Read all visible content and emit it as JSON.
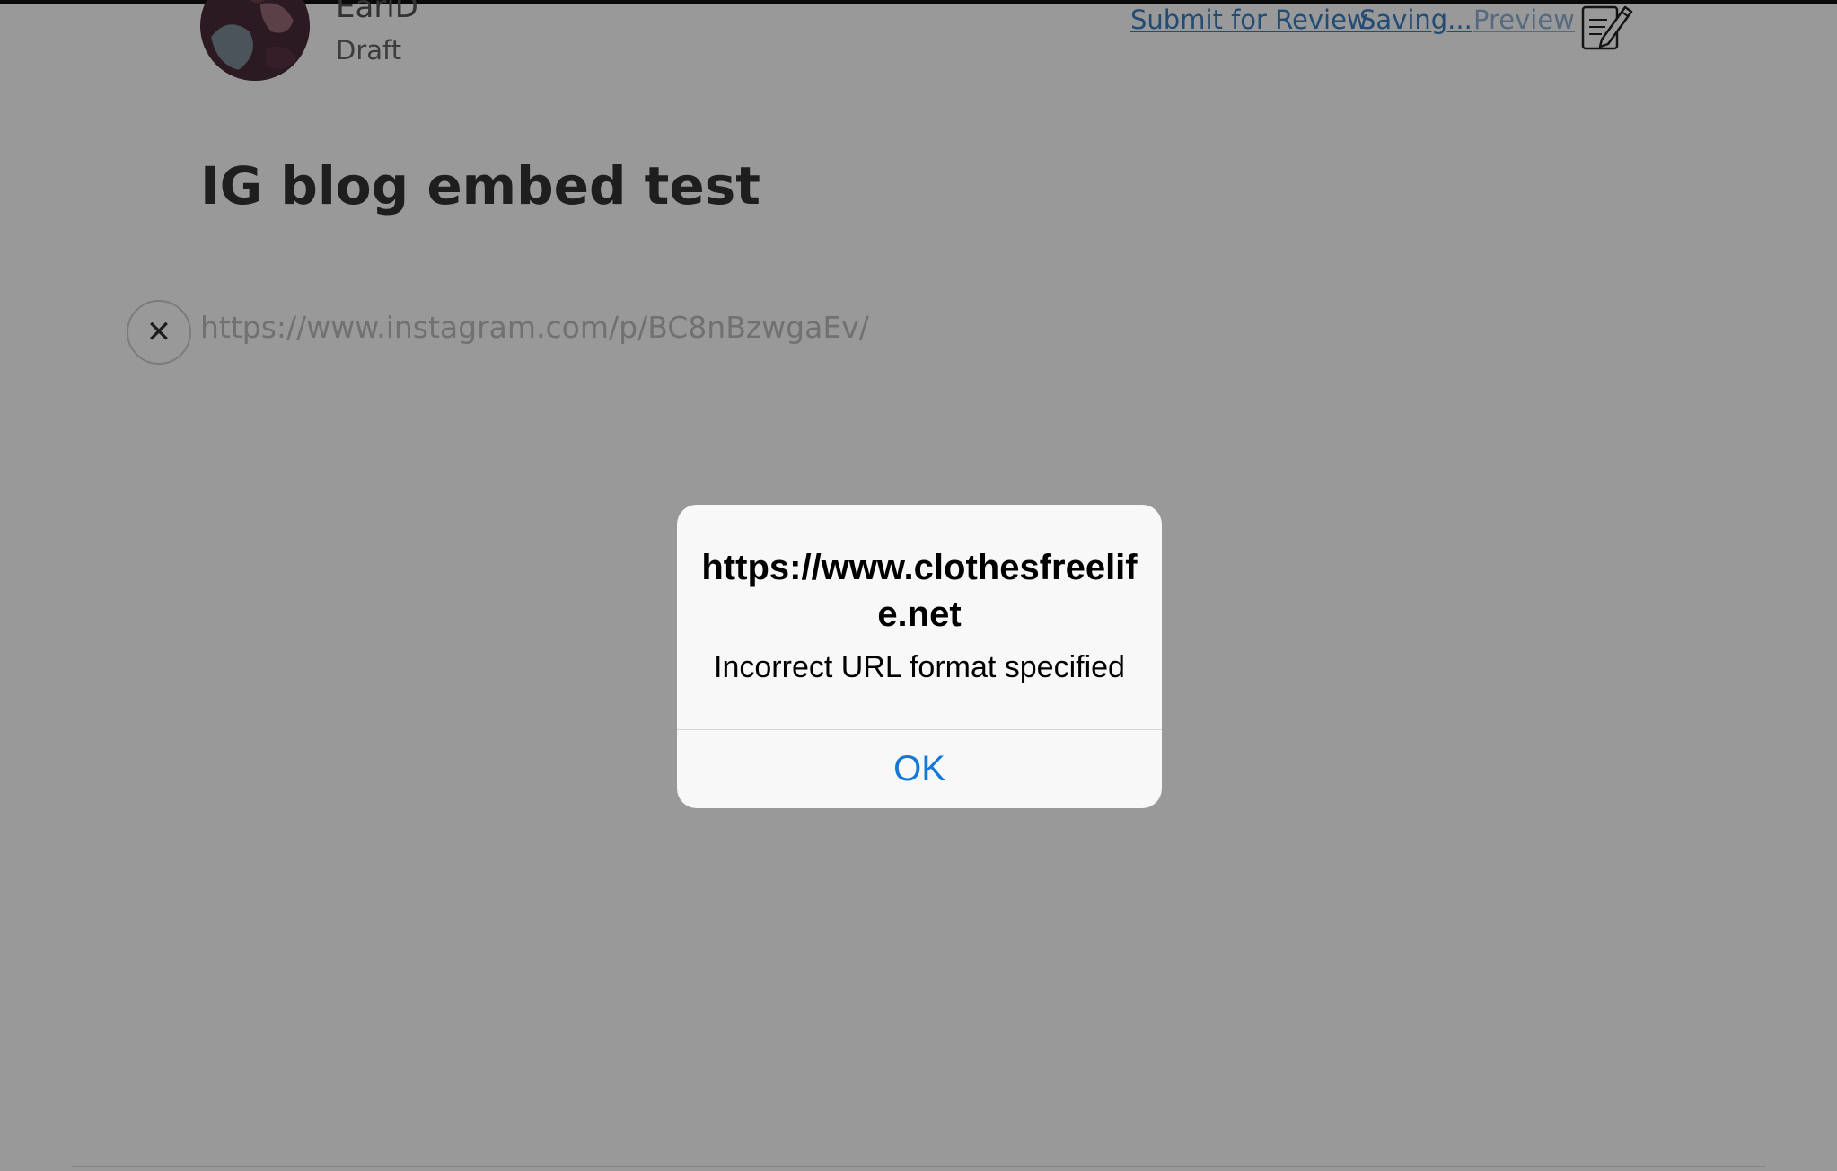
{
  "header": {
    "author_name": "EarlD",
    "status": "Draft"
  },
  "toolbar": {
    "submit_label": "Submit for Review",
    "saving_label": "Saving...",
    "preview_label": "Preview",
    "editor_icon": "edit-document-icon"
  },
  "post": {
    "title": "IG blog embed test",
    "embed_url": "https://www.instagram.com/p/BC8nBzwgaEv/"
  },
  "alert": {
    "title": "https://www.clothesfreelife.net",
    "message": "Incorrect URL format specified",
    "ok_label": "OK"
  },
  "colors": {
    "link": "#3b7fc4",
    "alert_button": "#1378d8",
    "overlay": "rgba(0,0,0,0.40)"
  }
}
